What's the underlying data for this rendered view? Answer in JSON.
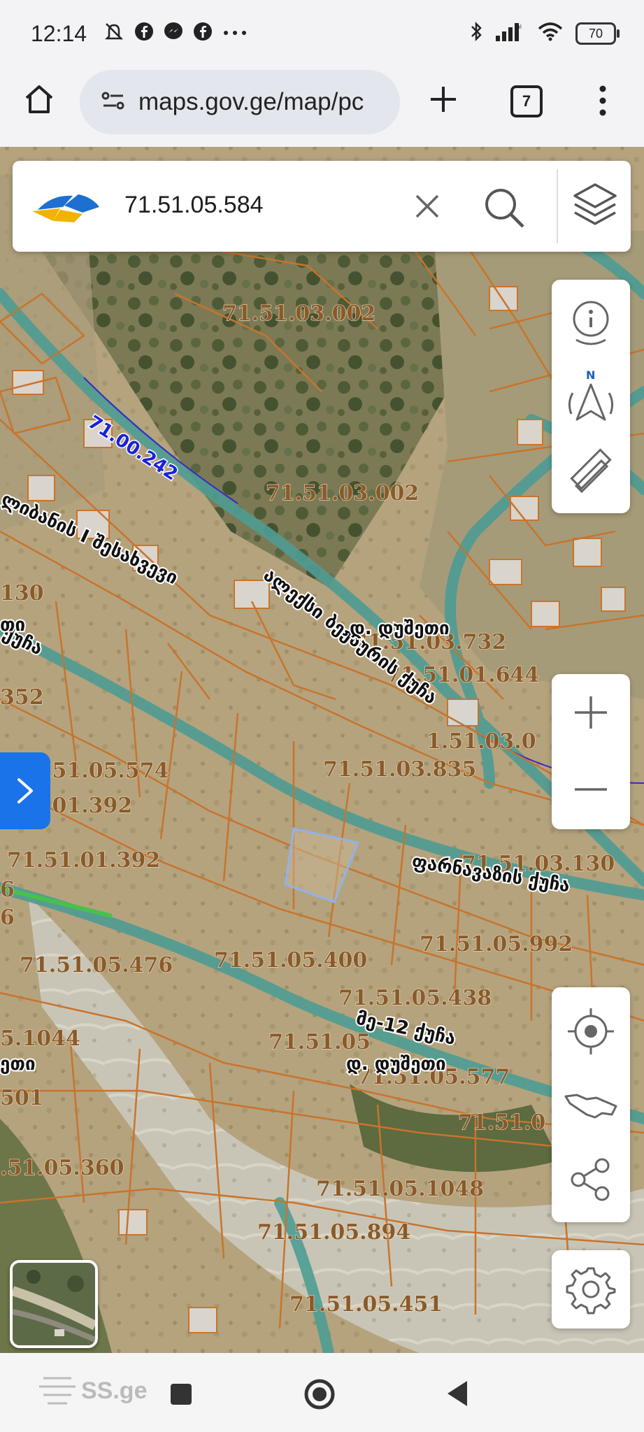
{
  "status_bar": {
    "time": "12:14",
    "battery": "70",
    "icons": [
      "mute-icon",
      "facebook-icon",
      "messenger-icon",
      "facebook-icon",
      "more-notifications-icon",
      "bluetooth-icon",
      "signal-icon",
      "wifi-icon",
      "battery-icon"
    ]
  },
  "browser": {
    "url": "maps.gov.ge/map/pc",
    "tab_count": "7"
  },
  "search": {
    "value": "71.51.05.584"
  },
  "map": {
    "parcel_labels": [
      "71.51.03.002",
      "71.51.03.002",
      "71.51.03.732",
      "71.51.01.644",
      "1.51.03.0",
      "71.51.03.835",
      ".51.05.574",
      ".01.392",
      "71.51.01.392",
      "71.51.03.130",
      "71.51.05.992",
      "71.51.05.476",
      "71.51.05.400",
      "71.51.05.438",
      "71.51.05",
      "71.51.05.577",
      "71.51.0",
      "5.1044",
      "501",
      "130",
      "352",
      ".51.05.360",
      "71.51.05.1048",
      "71.51.05.894",
      "71.51.05.451",
      "6",
      "6"
    ],
    "road_label": "71.00.242",
    "street_labels": [
      "ალექსი ბეჟაურის ქუჩა",
      "ფარნავაზის ქუჩა",
      "მე-12 ქუჩა",
      "ლიბანის I შესახვევი",
      "ქუჩა"
    ],
    "village_labels": [
      "დ. დუშეთი",
      "დ. დუშეთი",
      "თი",
      "ეთი"
    ]
  },
  "navbar": {
    "watermark": "SS.ge"
  },
  "colors": {
    "parcel_line": "#c8742c",
    "road": "#4e9c94",
    "accent": "#1a73e8",
    "selected_parcel": "#8fb3e8"
  }
}
